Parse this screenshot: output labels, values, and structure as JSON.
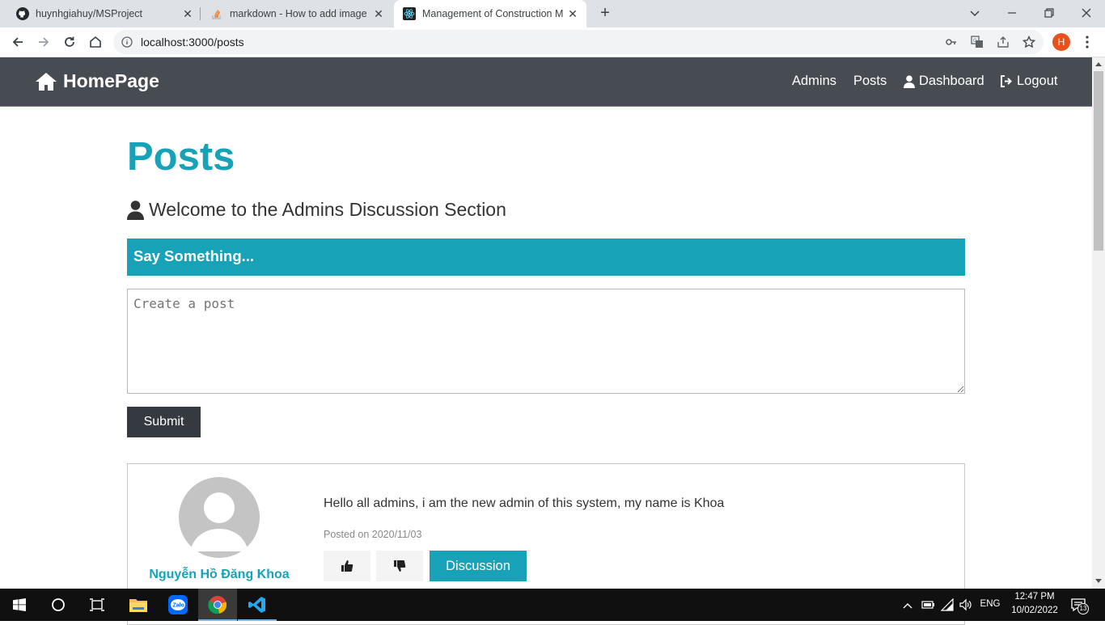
{
  "browser": {
    "tabs": [
      {
        "title": "huynhgiahuy/MSProject",
        "icon": "github-icon"
      },
      {
        "title": "markdown - How to add images",
        "icon": "stackoverflow-icon"
      },
      {
        "title": "Management of Construction Ma",
        "icon": "react-icon",
        "active": true
      }
    ],
    "url": "localhost:3000/posts",
    "profile_initial": "H"
  },
  "navbar": {
    "brand": "HomePage",
    "links": [
      "Admins",
      "Posts",
      "Dashboard",
      "Logout"
    ]
  },
  "main": {
    "title": "Posts",
    "welcome": "Welcome to the Admins Discussion Section",
    "say_header": "Say Something...",
    "textarea_placeholder": "Create a post",
    "submit_label": "Submit"
  },
  "post": {
    "author": "Nguyễn Hồ Đăng Khoa",
    "text": "Hello all admins, i am the new admin of this system, my name is Khoa",
    "date": "Posted on 2020/11/03",
    "discussion_label": "Discussion"
  },
  "taskbar": {
    "lang": "ENG",
    "time": "12:47 PM",
    "date": "10/02/2022",
    "notifications": "13"
  },
  "colors": {
    "accent": "#17a2b8",
    "navbar": "#474b52",
    "submit": "#343a40"
  }
}
